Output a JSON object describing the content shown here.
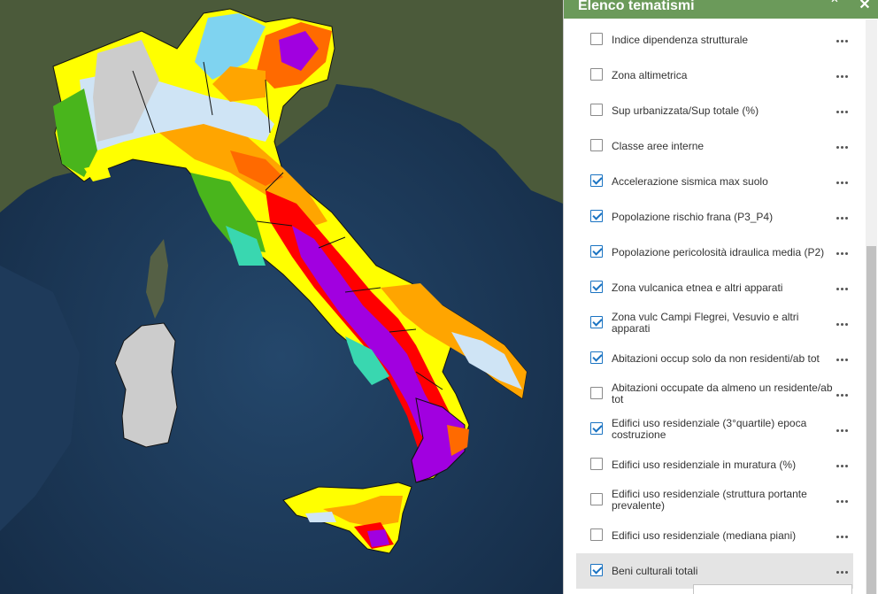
{
  "panel": {
    "title": "Elenco tematismi",
    "collapse_icon": "chevron-double-up-icon",
    "close_icon": "close-icon"
  },
  "layers": [
    {
      "label": "Indice dipendenza strutturale",
      "checked": false
    },
    {
      "label": "Zona altimetrica",
      "checked": false
    },
    {
      "label": "Sup urbanizzata/Sup totale (%)",
      "checked": false
    },
    {
      "label": "Classe aree interne",
      "checked": false
    },
    {
      "label": "Accelerazione sismica max suolo",
      "checked": true
    },
    {
      "label": "Popolazione rischio frana (P3_P4)",
      "checked": true
    },
    {
      "label": "Popolazione pericolosità idraulica media (P2)",
      "checked": true
    },
    {
      "label": "Zona vulcanica etnea e altri apparati",
      "checked": true
    },
    {
      "label": "Zona vulc Campi Flegrei, Vesuvio e altri apparati",
      "checked": true
    },
    {
      "label": "Abitazioni occup solo da non residenti/ab tot",
      "checked": true
    },
    {
      "label": "Abitazioni occupate da almeno un residente/ab tot",
      "checked": false
    },
    {
      "label": "Edifici uso residenziale (3°quartile) epoca costruzione",
      "checked": true
    },
    {
      "label": "Edifici uso residenziale in muratura (%)",
      "checked": false
    },
    {
      "label": "Edifici uso residenziale (struttura portante prevalente)",
      "checked": false
    },
    {
      "label": "Edifici uso residenziale (mediana piani)",
      "checked": false
    },
    {
      "label": "Beni culturali totali",
      "checked": true,
      "highlighted": true
    }
  ],
  "colors": {
    "header": "#6b9a5a",
    "checkbox_checked": "#1a73c2",
    "sea": "#1d3552",
    "hazard_low": "#cfe4f5",
    "hazard_1": "#7fd3f0",
    "hazard_2": "#39d7b0",
    "hazard_3": "#49b51c",
    "hazard_4": "#ffff00",
    "hazard_5": "#ffa500",
    "hazard_6": "#ff6a00",
    "hazard_7": "#ff0000",
    "hazard_8": "#a100e0"
  }
}
